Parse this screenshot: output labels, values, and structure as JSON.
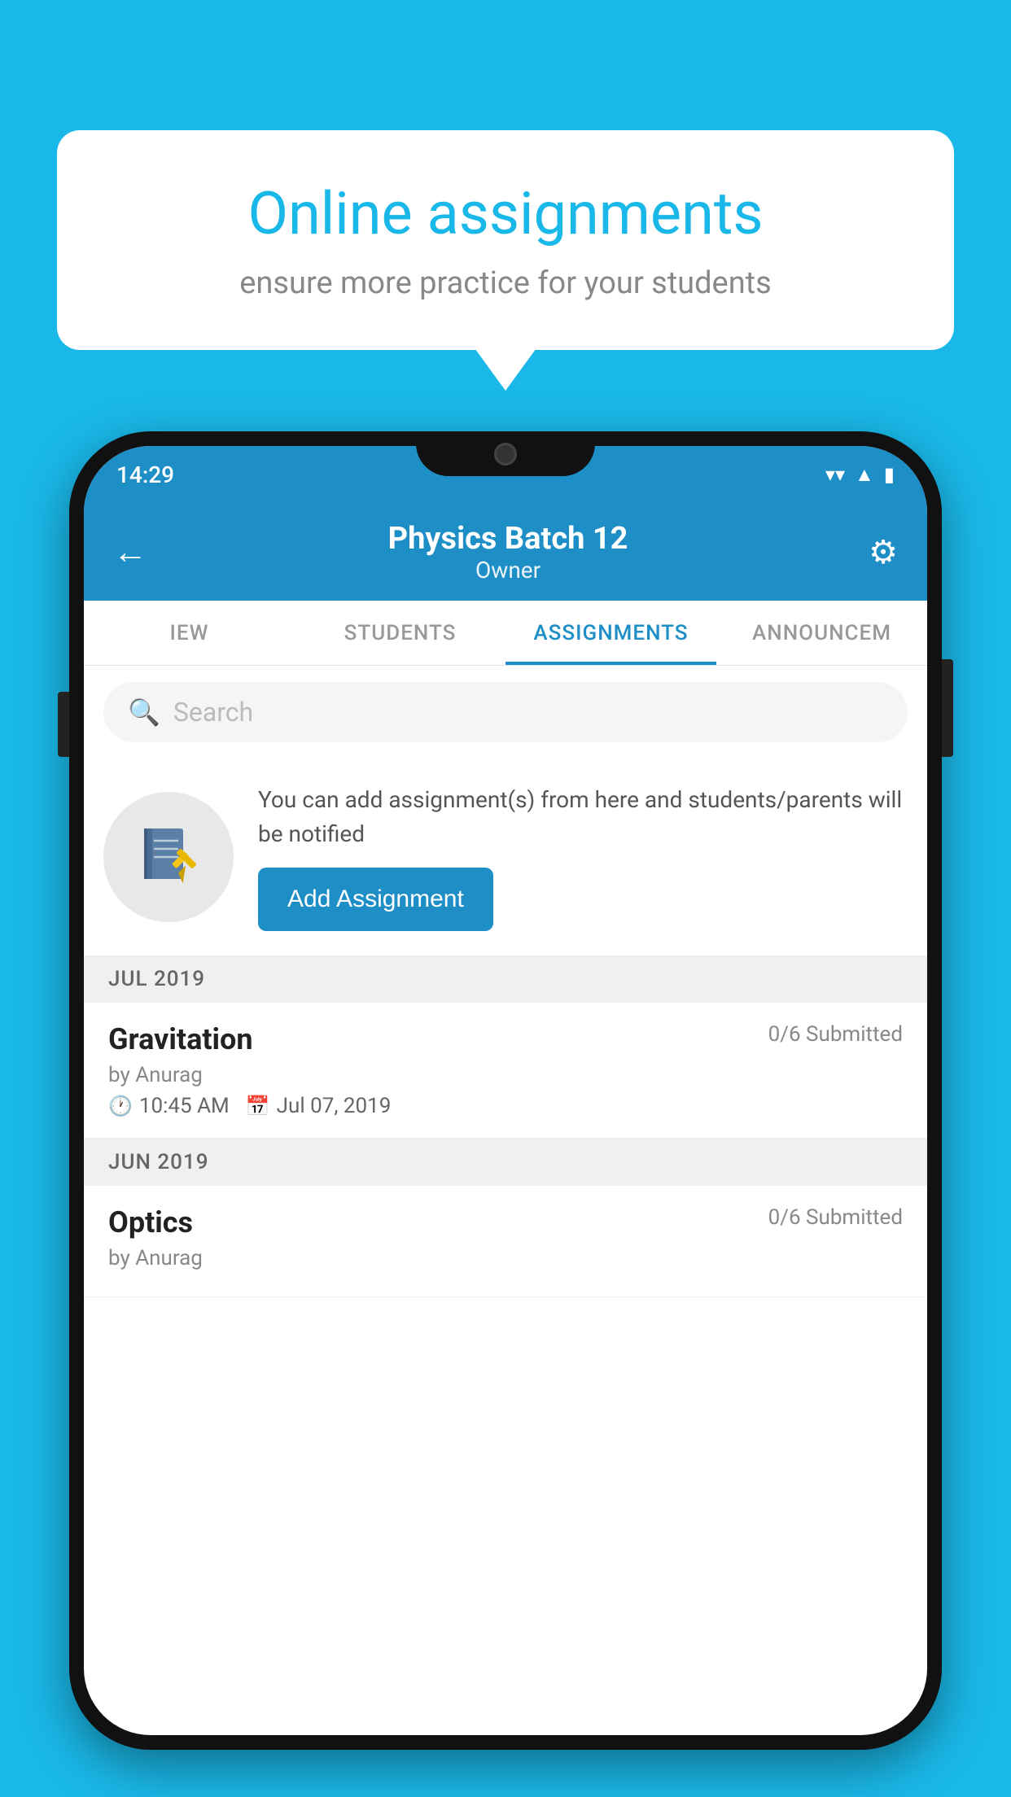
{
  "background_color": "#1ab8e8",
  "speech_bubble": {
    "title": "Online assignments",
    "subtitle": "ensure more practice for your students"
  },
  "status_bar": {
    "time": "14:29",
    "icons": [
      "wifi",
      "signal",
      "battery"
    ]
  },
  "app_header": {
    "title": "Physics Batch 12",
    "subtitle": "Owner",
    "back_label": "←",
    "settings_label": "⚙"
  },
  "tabs": [
    {
      "label": "IEW",
      "active": false
    },
    {
      "label": "STUDENTS",
      "active": false
    },
    {
      "label": "ASSIGNMENTS",
      "active": true
    },
    {
      "label": "ANNOUNCEM",
      "active": false
    }
  ],
  "search": {
    "placeholder": "Search"
  },
  "info": {
    "description": "You can add assignment(s) from here and students/parents will be notified",
    "add_button_label": "Add Assignment"
  },
  "sections": [
    {
      "month_label": "JUL 2019",
      "assignments": [
        {
          "title": "Gravitation",
          "submitted": "0/6 Submitted",
          "author": "by Anurag",
          "time": "10:45 AM",
          "date": "Jul 07, 2019"
        }
      ]
    },
    {
      "month_label": "JUN 2019",
      "assignments": [
        {
          "title": "Optics",
          "submitted": "0/6 Submitted",
          "author": "by Anurag",
          "time": "",
          "date": ""
        }
      ]
    }
  ]
}
